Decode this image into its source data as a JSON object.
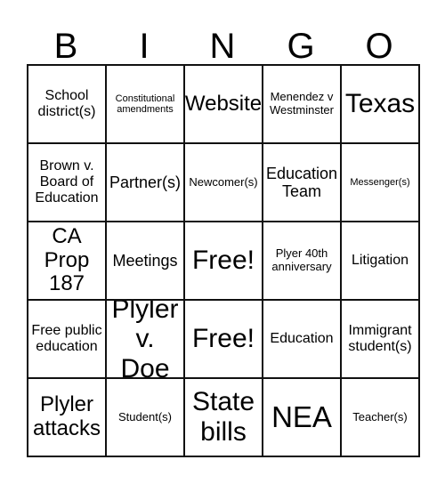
{
  "card": {
    "header_letters": [
      "B",
      "I",
      "N",
      "G",
      "O"
    ],
    "rows": [
      [
        {
          "text": "School district(s)",
          "size": "md"
        },
        {
          "text": "Constitutional amendments",
          "size": "xs"
        },
        {
          "text": "Website",
          "size": "xl"
        },
        {
          "text": "Menendez v Westminster",
          "size": "sm"
        },
        {
          "text": "Texas",
          "size": "xxl"
        }
      ],
      [
        {
          "text": "Brown v. Board of Education",
          "size": "md"
        },
        {
          "text": "Partner(s)",
          "size": "lg"
        },
        {
          "text": "Newcomer(s)",
          "size": "sm"
        },
        {
          "text": "Education Team",
          "size": "lg"
        },
        {
          "text": "Messenger(s)",
          "size": "xs"
        }
      ],
      [
        {
          "text": "CA Prop 187",
          "size": "xl"
        },
        {
          "text": "Meetings",
          "size": "lg"
        },
        {
          "text": "Free!",
          "size": "xxl"
        },
        {
          "text": "Plyer 40th anniversary",
          "size": "sm"
        },
        {
          "text": "Litigation",
          "size": "md"
        }
      ],
      [
        {
          "text": "Free public education",
          "size": "md"
        },
        {
          "text": "Plyler v. Doe",
          "size": "xxl"
        },
        {
          "text": "Free!",
          "size": "xxl"
        },
        {
          "text": "Education",
          "size": "md"
        },
        {
          "text": "Immigrant student(s)",
          "size": "md"
        }
      ],
      [
        {
          "text": "Plyler attacks",
          "size": "xl"
        },
        {
          "text": "Student(s)",
          "size": "sm"
        },
        {
          "text": "State bills",
          "size": "xxl"
        },
        {
          "text": "NEA",
          "size": "huge"
        },
        {
          "text": "Teacher(s)",
          "size": "sm"
        }
      ]
    ]
  }
}
